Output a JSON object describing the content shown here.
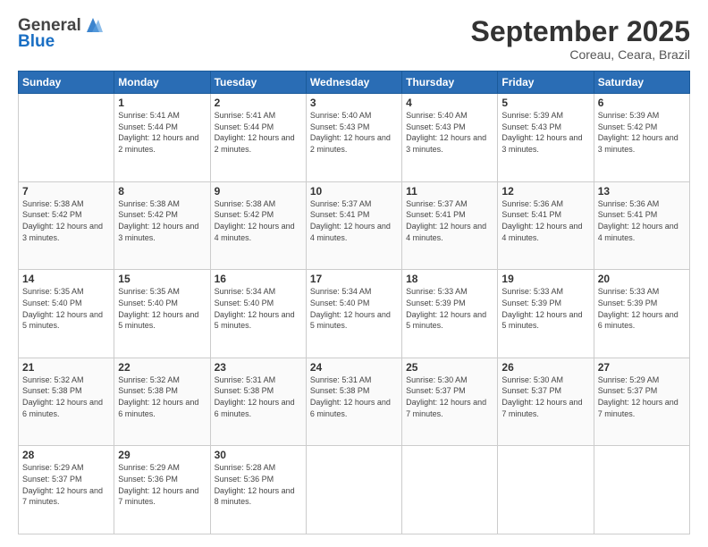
{
  "logo": {
    "general": "General",
    "blue": "Blue"
  },
  "header": {
    "month": "September 2025",
    "location": "Coreau, Ceara, Brazil"
  },
  "days_of_week": [
    "Sunday",
    "Monday",
    "Tuesday",
    "Wednesday",
    "Thursday",
    "Friday",
    "Saturday"
  ],
  "weeks": [
    [
      {
        "day": "",
        "sunrise": "",
        "sunset": "",
        "daylight": ""
      },
      {
        "day": "1",
        "sunrise": "Sunrise: 5:41 AM",
        "sunset": "Sunset: 5:44 PM",
        "daylight": "Daylight: 12 hours and 2 minutes."
      },
      {
        "day": "2",
        "sunrise": "Sunrise: 5:41 AM",
        "sunset": "Sunset: 5:44 PM",
        "daylight": "Daylight: 12 hours and 2 minutes."
      },
      {
        "day": "3",
        "sunrise": "Sunrise: 5:40 AM",
        "sunset": "Sunset: 5:43 PM",
        "daylight": "Daylight: 12 hours and 2 minutes."
      },
      {
        "day": "4",
        "sunrise": "Sunrise: 5:40 AM",
        "sunset": "Sunset: 5:43 PM",
        "daylight": "Daylight: 12 hours and 3 minutes."
      },
      {
        "day": "5",
        "sunrise": "Sunrise: 5:39 AM",
        "sunset": "Sunset: 5:43 PM",
        "daylight": "Daylight: 12 hours and 3 minutes."
      },
      {
        "day": "6",
        "sunrise": "Sunrise: 5:39 AM",
        "sunset": "Sunset: 5:42 PM",
        "daylight": "Daylight: 12 hours and 3 minutes."
      }
    ],
    [
      {
        "day": "7",
        "sunrise": "Sunrise: 5:38 AM",
        "sunset": "Sunset: 5:42 PM",
        "daylight": "Daylight: 12 hours and 3 minutes."
      },
      {
        "day": "8",
        "sunrise": "Sunrise: 5:38 AM",
        "sunset": "Sunset: 5:42 PM",
        "daylight": "Daylight: 12 hours and 3 minutes."
      },
      {
        "day": "9",
        "sunrise": "Sunrise: 5:38 AM",
        "sunset": "Sunset: 5:42 PM",
        "daylight": "Daylight: 12 hours and 4 minutes."
      },
      {
        "day": "10",
        "sunrise": "Sunrise: 5:37 AM",
        "sunset": "Sunset: 5:41 PM",
        "daylight": "Daylight: 12 hours and 4 minutes."
      },
      {
        "day": "11",
        "sunrise": "Sunrise: 5:37 AM",
        "sunset": "Sunset: 5:41 PM",
        "daylight": "Daylight: 12 hours and 4 minutes."
      },
      {
        "day": "12",
        "sunrise": "Sunrise: 5:36 AM",
        "sunset": "Sunset: 5:41 PM",
        "daylight": "Daylight: 12 hours and 4 minutes."
      },
      {
        "day": "13",
        "sunrise": "Sunrise: 5:36 AM",
        "sunset": "Sunset: 5:41 PM",
        "daylight": "Daylight: 12 hours and 4 minutes."
      }
    ],
    [
      {
        "day": "14",
        "sunrise": "Sunrise: 5:35 AM",
        "sunset": "Sunset: 5:40 PM",
        "daylight": "Daylight: 12 hours and 5 minutes."
      },
      {
        "day": "15",
        "sunrise": "Sunrise: 5:35 AM",
        "sunset": "Sunset: 5:40 PM",
        "daylight": "Daylight: 12 hours and 5 minutes."
      },
      {
        "day": "16",
        "sunrise": "Sunrise: 5:34 AM",
        "sunset": "Sunset: 5:40 PM",
        "daylight": "Daylight: 12 hours and 5 minutes."
      },
      {
        "day": "17",
        "sunrise": "Sunrise: 5:34 AM",
        "sunset": "Sunset: 5:40 PM",
        "daylight": "Daylight: 12 hours and 5 minutes."
      },
      {
        "day": "18",
        "sunrise": "Sunrise: 5:33 AM",
        "sunset": "Sunset: 5:39 PM",
        "daylight": "Daylight: 12 hours and 5 minutes."
      },
      {
        "day": "19",
        "sunrise": "Sunrise: 5:33 AM",
        "sunset": "Sunset: 5:39 PM",
        "daylight": "Daylight: 12 hours and 5 minutes."
      },
      {
        "day": "20",
        "sunrise": "Sunrise: 5:33 AM",
        "sunset": "Sunset: 5:39 PM",
        "daylight": "Daylight: 12 hours and 6 minutes."
      }
    ],
    [
      {
        "day": "21",
        "sunrise": "Sunrise: 5:32 AM",
        "sunset": "Sunset: 5:38 PM",
        "daylight": "Daylight: 12 hours and 6 minutes."
      },
      {
        "day": "22",
        "sunrise": "Sunrise: 5:32 AM",
        "sunset": "Sunset: 5:38 PM",
        "daylight": "Daylight: 12 hours and 6 minutes."
      },
      {
        "day": "23",
        "sunrise": "Sunrise: 5:31 AM",
        "sunset": "Sunset: 5:38 PM",
        "daylight": "Daylight: 12 hours and 6 minutes."
      },
      {
        "day": "24",
        "sunrise": "Sunrise: 5:31 AM",
        "sunset": "Sunset: 5:38 PM",
        "daylight": "Daylight: 12 hours and 6 minutes."
      },
      {
        "day": "25",
        "sunrise": "Sunrise: 5:30 AM",
        "sunset": "Sunset: 5:37 PM",
        "daylight": "Daylight: 12 hours and 7 minutes."
      },
      {
        "day": "26",
        "sunrise": "Sunrise: 5:30 AM",
        "sunset": "Sunset: 5:37 PM",
        "daylight": "Daylight: 12 hours and 7 minutes."
      },
      {
        "day": "27",
        "sunrise": "Sunrise: 5:29 AM",
        "sunset": "Sunset: 5:37 PM",
        "daylight": "Daylight: 12 hours and 7 minutes."
      }
    ],
    [
      {
        "day": "28",
        "sunrise": "Sunrise: 5:29 AM",
        "sunset": "Sunset: 5:37 PM",
        "daylight": "Daylight: 12 hours and 7 minutes."
      },
      {
        "day": "29",
        "sunrise": "Sunrise: 5:29 AM",
        "sunset": "Sunset: 5:36 PM",
        "daylight": "Daylight: 12 hours and 7 minutes."
      },
      {
        "day": "30",
        "sunrise": "Sunrise: 5:28 AM",
        "sunset": "Sunset: 5:36 PM",
        "daylight": "Daylight: 12 hours and 8 minutes."
      },
      {
        "day": "",
        "sunrise": "",
        "sunset": "",
        "daylight": ""
      },
      {
        "day": "",
        "sunrise": "",
        "sunset": "",
        "daylight": ""
      },
      {
        "day": "",
        "sunrise": "",
        "sunset": "",
        "daylight": ""
      },
      {
        "day": "",
        "sunrise": "",
        "sunset": "",
        "daylight": ""
      }
    ]
  ]
}
